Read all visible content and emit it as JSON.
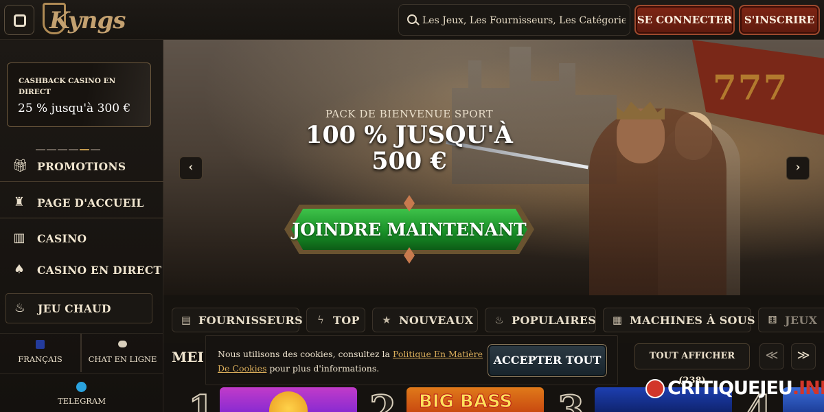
{
  "header": {
    "logo_text": "Kyngs",
    "search_placeholder": "Les Jeux, Les Fournisseurs, Les Catégories",
    "login_label": "SE CONNECTER",
    "signup_label": "S'INSCRIRE"
  },
  "sidebar": {
    "cashback_title": "CASHBACK CASINO EN DIRECT",
    "cashback_offer": "25 % jusqu'à 300 €",
    "items": [
      {
        "label": "PROMOTIONS",
        "icon": "gift-icon"
      },
      {
        "label": "PAGE D'ACCUEIL",
        "icon": "castle-icon"
      },
      {
        "label": "CASINO",
        "icon": "casino-building-icon"
      },
      {
        "label": "CASINO EN DIRECT",
        "icon": "cards-icon"
      },
      {
        "label": "JEU CHAUD",
        "icon": "flame-icon"
      }
    ],
    "language_label": "FRANÇAIS",
    "chat_label": "CHAT EN LIGNE",
    "telegram_label": "TELEGRAM"
  },
  "hero": {
    "subtitle": "PACK DE BIENVENUE SPORT",
    "headline": "100 % JUSQU'À 500 €",
    "cta_label": "JOINDRE MAINTENANT",
    "banner_text": "777",
    "prev_arrow": "‹",
    "next_arrow": "›"
  },
  "tabs": [
    {
      "label": "FOURNISSEURS",
      "icon": "book-icon"
    },
    {
      "label": "TOP",
      "icon": "lightning-icon"
    },
    {
      "label": "NOUVEAUX",
      "icon": "star-icon"
    },
    {
      "label": "POPULAIRES",
      "icon": "flame-icon"
    },
    {
      "label": "MACHINES À SOUS",
      "icon": "slot-machine-icon"
    },
    {
      "label": "JEUX",
      "icon": "dice-icon"
    }
  ],
  "games": {
    "section_title": "MEI",
    "show_all_label": "TOUT AFFICHER (238)",
    "prev_label": "≪",
    "next_label": "≫",
    "ranks": [
      "1",
      "2",
      "3",
      "4"
    ],
    "card2_title": "BIG BASS"
  },
  "cookie": {
    "text_before": "Nous utilisons des cookies, consultez la ",
    "link_text": "Politique En Matière De Cookies",
    "text_after": " pour plus d'informations.",
    "accept_label": "ACCEPTER TOUT"
  },
  "watermark": {
    "text_main": "CRITIQUEJEU",
    "text_suffix": ".INFO"
  },
  "colors": {
    "accent_red": "#7e2514",
    "cta_green": "#178c26",
    "gold": "#c39a4f",
    "background": "#141210"
  }
}
